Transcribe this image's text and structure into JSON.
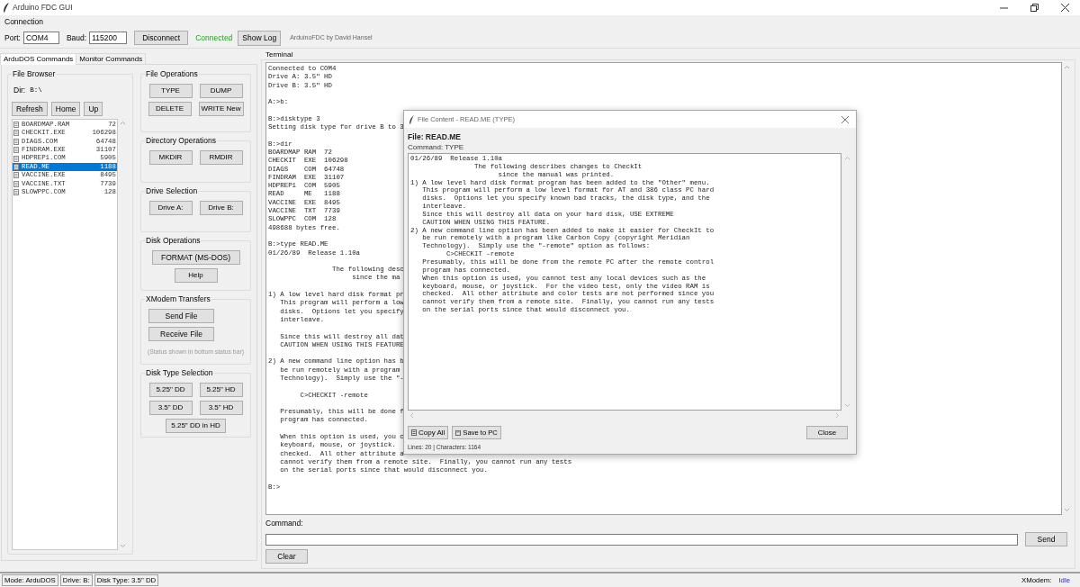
{
  "window": {
    "title": "Arduino FDC GUI"
  },
  "connection": {
    "title": "Connection",
    "port_label": "Port:",
    "port": "COM4",
    "baud_label": "Baud:",
    "baud": "115200",
    "disconnect_button": "Disconnect",
    "status": "Connected",
    "connected": true,
    "log_button": "Show Log",
    "credit": "ArduinoFDC by David Hansel"
  },
  "tabs": [
    {
      "label": "ArduDOS Commands",
      "selected": true
    },
    {
      "label": "Monitor Commands",
      "selected": false
    }
  ],
  "file_browser": {
    "title": "File Browser",
    "dir_label": "Dir:",
    "dir": "B:\\",
    "buttons": [
      "Refresh",
      "Home",
      "Up"
    ],
    "files": [
      {
        "name": "BOARDMAP.RAM",
        "size": "72",
        "selected": false
      },
      {
        "name": "CHECKIT.EXE",
        "size": "106298",
        "selected": false
      },
      {
        "name": "DIAGS.COM",
        "size": "64748",
        "selected": false
      },
      {
        "name": "FINDRAM.EXE",
        "size": "31107",
        "selected": false
      },
      {
        "name": "HDPREP1.COM",
        "size": "5905",
        "selected": false
      },
      {
        "name": "READ.ME",
        "size": "1188",
        "selected": true
      },
      {
        "name": "VACCINE.EXE",
        "size": "8495",
        "selected": false
      },
      {
        "name": "VACCINE.TXT",
        "size": "7739",
        "selected": false
      },
      {
        "name": "SLOWPPC.COM",
        "size": "128",
        "selected": false
      }
    ]
  },
  "groups": [
    {
      "title": "File Operations",
      "rows": [
        [
          "TYPE",
          "DUMP"
        ],
        [
          "DELETE",
          "WRITE New"
        ]
      ]
    },
    {
      "title": "Directory Operations",
      "rows": [
        [
          "MKDIR",
          "RMDIR"
        ]
      ]
    },
    {
      "title": "Drive Selection",
      "rows": [
        [
          "Drive A:",
          "Drive B:"
        ]
      ]
    },
    {
      "title": "Disk Operations",
      "rows": [
        [
          "FORMAT (MS-DOS)"
        ],
        [
          "Help"
        ]
      ]
    },
    {
      "title": "XModem Transfers",
      "rows": [
        [
          "Send File"
        ],
        [
          "Receive File"
        ]
      ],
      "note": "(Status shown in bottom status bar)"
    },
    {
      "title": "Disk Type Selection",
      "rows": [
        [
          "5.25\" DD",
          "5.25\" HD"
        ],
        [
          "3.5\" DD",
          "3.5\" HD"
        ],
        [
          "5.25\" DD in HD"
        ]
      ]
    }
  ],
  "terminal": {
    "title": "Terminal",
    "blocks": [
      [
        "Connected to COM4",
        "Drive A: 3.5\" HD",
        "Drive B: 3.5\" HD"
      ],
      [
        "A:>b:"
      ],
      [
        "B:>disktype 3",
        "Setting disk type for drive B to 3"
      ],
      [
        "B:>dir",
        "BOARDMAP RAM  72",
        "CHECKIT  EXE  106298",
        "DIAGS    COM  64748",
        "FINDRAM  EXE  31107",
        "HDPREP1  COM  5905",
        "READ     ME   1188",
        "VACCINE  EXE  8495",
        "VACCINE  TXT  7739",
        "SLOWPPC  COM  128",
        "498688 bytes free."
      ],
      [
        "B:>type READ.ME",
        "01/26/89  Release 1.10a"
      ],
      [
        "                The following desc",
        "                     since the ma"
      ],
      [
        "1) A low level hard disk format pr",
        "   This program will perform a low",
        "   disks.  Options let you specify",
        "   interleave."
      ],
      [
        "   Since this will destroy all dat",
        "   CAUTION WHEN USING THIS FEATURE"
      ],
      [
        "2) A new command line option has b",
        "   be run remotely with a program",
        "   Technology).  Simply use the \"-"
      ],
      [
        "        C>CHECKIT -remote"
      ],
      [
        "   Presumably, this will be done f",
        "   program has connected."
      ],
      [
        "   When this option is used, you c",
        "   keyboard, mouse, or joystick.",
        "   checked.  All other attribute a",
        "   cannot verify them from a remote site.  Finally, you cannot run any tests",
        "   on the serial ports since that would disconnect you."
      ],
      [
        "B:>"
      ]
    ]
  },
  "command": {
    "label": "Command:",
    "send_button": "Send",
    "clear_button": "Clear"
  },
  "dialog": {
    "title": "File Content - READ.ME (TYPE)",
    "file": "File: READ.ME",
    "command": "Command: TYPE",
    "lines": [
      "01/26/89  Release 1.10a",
      "                The following describes changes to CheckIt",
      "                      since the manual was printed.",
      "1) A low level hard disk format program has been added to the \"Other\" menu.",
      "   This program will perform a low level format for AT and 386 class PC hard",
      "   disks.  Options let you specify known bad tracks, the disk type, and the",
      "   interleave.",
      "   Since this will destroy all data on your hard disk, USE EXTREME",
      "   CAUTION WHEN USING THIS FEATURE.",
      "2) A new command line option has been added to make it easier for CheckIt to",
      "   be run remotely with a program like Carbon Copy (copyright Meridian",
      "   Technology).  Simply use the \"-remote\" option as follows:",
      "         C>CHECKIT -remote",
      "   Presumably, this will be done from the remote PC after the remote control",
      "   program has connected.",
      "   When this option is used, you cannot test any local devices such as the",
      "   keyboard, mouse, or joystick.  For the video test, only the video RAM is",
      "   checked.  All other attribute and color tests are not performed since you",
      "   cannot verify them from a remote site.  Finally, you cannot run any tests",
      "   on the serial ports since that would disconnect you."
    ],
    "copy_button": "Copy All",
    "save_button": "Save to PC",
    "close_button": "Close",
    "stats": "Lines: 20 | Characters: 1164"
  },
  "status_bar": {
    "mode": "Mode: ArduDOS",
    "drive": "Drive: B:",
    "disk_type": "Disk Type: 3.5\" DD",
    "xmodem_label": "XModem:",
    "xmodem_state": "Idle"
  }
}
